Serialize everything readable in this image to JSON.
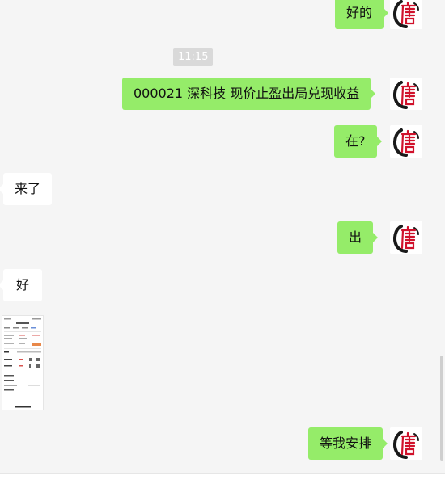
{
  "messages": [
    {
      "side": "out",
      "text": "好的"
    },
    {
      "side": "time",
      "text": "11:15"
    },
    {
      "side": "out",
      "text": "000021   深科技  现价止盈出局兑现收益"
    },
    {
      "side": "out",
      "text": "在?"
    },
    {
      "side": "in",
      "text": "来了"
    },
    {
      "side": "out",
      "text": "出"
    },
    {
      "side": "in",
      "text": "好"
    },
    {
      "side": "in",
      "type": "image"
    },
    {
      "side": "out",
      "text": "等我安排"
    }
  ],
  "avatar": {
    "icon": "tang-seal-avatar-icon",
    "ring_color": "#1a1a1a",
    "glyph_color": "#d0112b"
  },
  "colors": {
    "outgoing_bubble": "#95ec69",
    "incoming_bubble": "#ffffff",
    "background": "#f5f5f5"
  }
}
